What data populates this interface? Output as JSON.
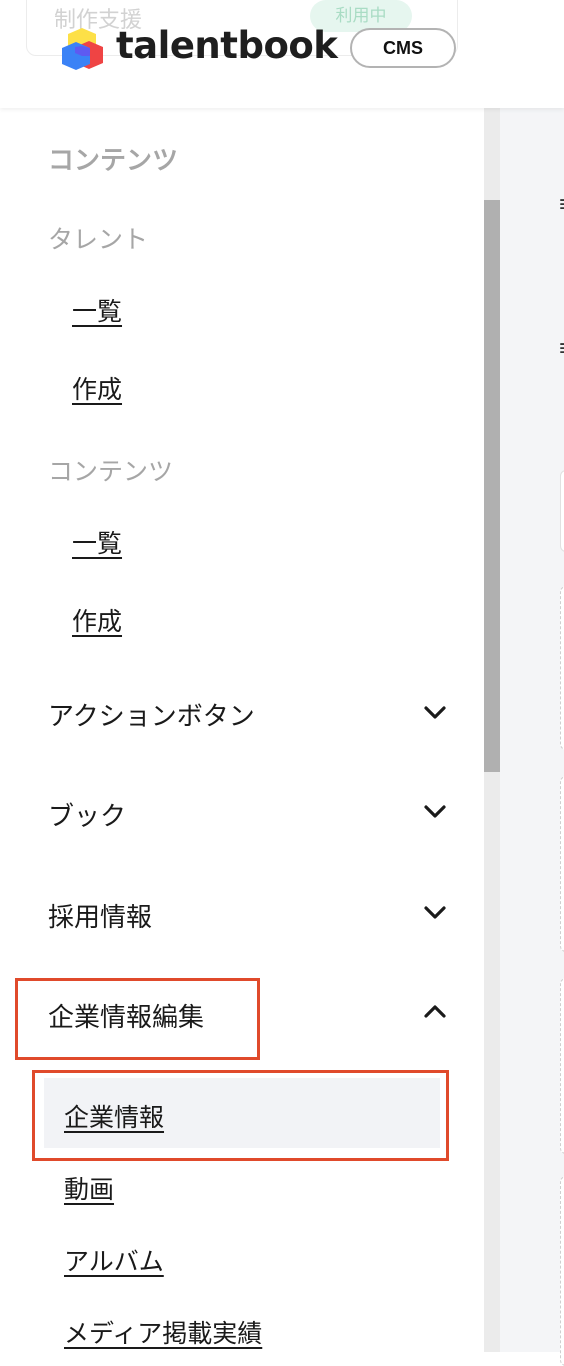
{
  "header": {
    "ghost_text": "制作支援",
    "ghost_badge": "利用中",
    "brand_name": "talentbook",
    "cms_badge": "CMS",
    "logo_colors": [
      "#fde047",
      "#ef4444",
      "#3b82f6"
    ]
  },
  "sidebar": {
    "section_title": "コンテンツ",
    "groups": [
      {
        "title": "タレント",
        "links": [
          "一覧",
          "作成"
        ]
      },
      {
        "title": "コンテンツ",
        "links": [
          "一覧",
          "作成"
        ]
      }
    ],
    "menus": [
      {
        "label": "アクションボタン",
        "expanded": false
      },
      {
        "label": "ブック",
        "expanded": false
      },
      {
        "label": "採用情報",
        "expanded": false
      },
      {
        "label": "企業情報編集",
        "expanded": true
      }
    ],
    "company_submenu": [
      "企業情報",
      "動画",
      "アルバム",
      "メディア掲載実績"
    ],
    "active_item": "企業情報"
  },
  "colors": {
    "highlight": "#e04a2b",
    "muted_text": "#a6a6a6",
    "text": "#1a1a1a",
    "active_bg": "#f2f3f6"
  }
}
